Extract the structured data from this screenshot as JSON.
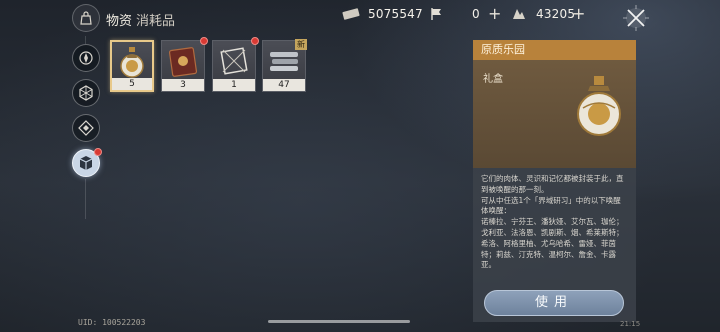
{
  "header": {
    "title": "物资",
    "subtitle": "消耗品",
    "currencies": [
      {
        "icon": "ticket-icon",
        "value": "5075547"
      },
      {
        "icon": "flag-icon",
        "value": "0"
      },
      {
        "icon": "crystal-icon",
        "value": "43205"
      }
    ],
    "plus_label": "+"
  },
  "nav": {
    "items": [
      {
        "icon": "compass-icon"
      },
      {
        "icon": "hex-network-icon"
      },
      {
        "icon": "diamond-target-icon"
      },
      {
        "icon": "cube-icon",
        "active": true
      }
    ]
  },
  "inventory": {
    "slots": [
      {
        "item": "gift-flask",
        "count": "5",
        "selected": true
      },
      {
        "item": "red-tome",
        "count": "3",
        "badge": true
      },
      {
        "item": "frame-box",
        "count": "1",
        "badge": true
      },
      {
        "item": "metal-bars",
        "count": "47",
        "new_tag": "新"
      }
    ]
  },
  "detail": {
    "header": "原质乐园",
    "type_label": "礼盒",
    "description": "它们的肉体、灵识和记忆都被封装于此，直到被唤醒的那一刻。\n可从中任选1个「界域研习」中的以下唤醒体唤醒：\n诺榛拉、宁芬王、潘狄娅、艾尔瓦、珈伦；戈利亚、法洛恩、凯剧斯、烟、希莱斯特；希洛、阿格里柚、尤乌哈希、雷娅、菲茵特；莉兹、汀克特、温柯尔、詹金、卡露亚。",
    "use_button": "使用"
  },
  "footer": {
    "uid": "UID: 100522203",
    "time": "21:15"
  },
  "colors": {
    "panel_header": "#b8823b",
    "selected_border": "#e8c98a",
    "badge": "#d83a34",
    "use_button": "#7f93ad"
  }
}
